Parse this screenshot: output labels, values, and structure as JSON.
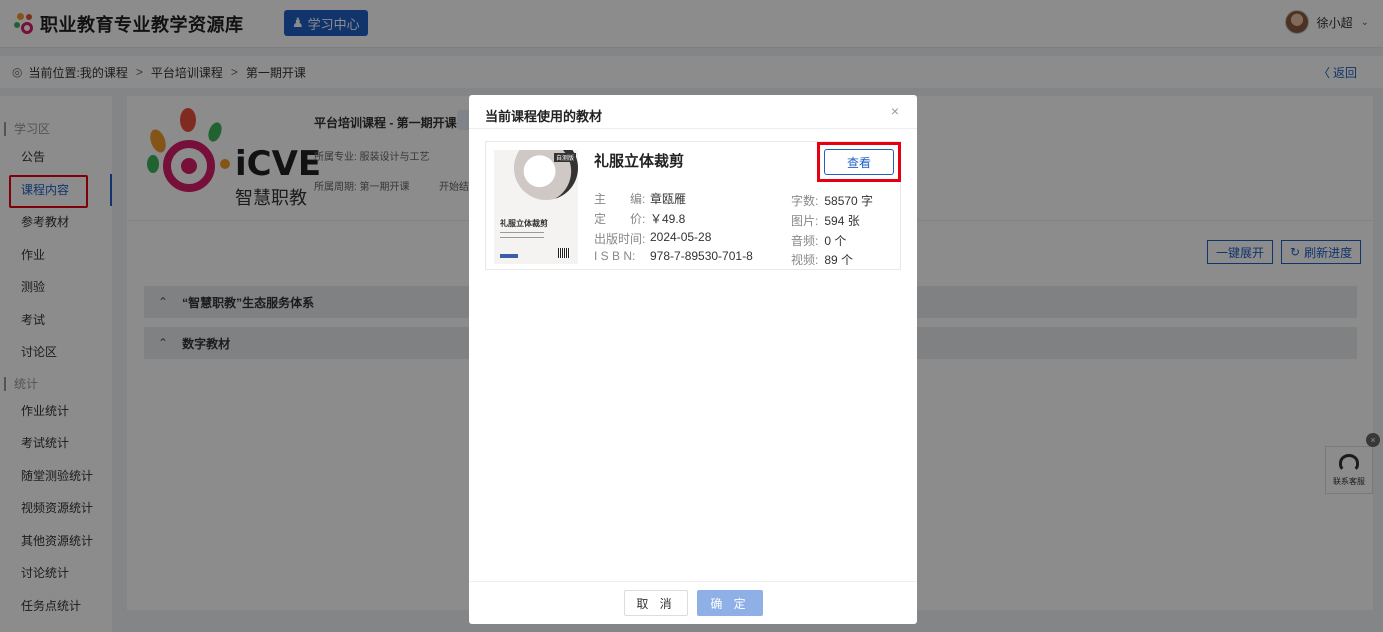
{
  "header": {
    "app_title": "职业教育专业教学资源库",
    "learning_center": "学习中心",
    "user_name": "徐小超"
  },
  "breadcrumb": {
    "prefix": "当前位置:",
    "items": [
      "我的课程",
      "平台培训课程",
      "第一期开课"
    ],
    "back": "返回"
  },
  "sidebar": {
    "section_study": "学习区",
    "study_items": [
      "公告",
      "课程内容",
      "参考教材",
      "作业",
      "测验",
      "考试",
      "讨论区"
    ],
    "section_stats": "统计",
    "stats_items": [
      "作业统计",
      "考试统计",
      "随堂测验统计",
      "视频资源统计",
      "其他资源统计",
      "讨论统计",
      "任务点统计"
    ]
  },
  "course": {
    "title": "平台培训课程 - 第一期开课",
    "major": "所属专业: 服装设计与工艺",
    "period": "所属周期: 第一期开课",
    "start": "开始结",
    "logo_text": "iCVE",
    "logo_subtext": "智慧职教"
  },
  "toolbar": {
    "expand_all": "一键展开",
    "refresh": "刷新进度"
  },
  "sections": [
    "“智慧职教”生态服务体系",
    "数字教材"
  ],
  "service": {
    "label": "联系客服"
  },
  "modal": {
    "title": "当前课程使用的教材",
    "book": {
      "title": "礼服立体裁剪",
      "view": "查看",
      "cover_badge": "自测版",
      "cover_title": "礼服立体裁剪",
      "editor_label": "主　　编:",
      "editor": "章瓯雁",
      "price_label": "定　　价:",
      "price": "￥49.8",
      "date_label": "出版时间:",
      "date": "2024-05-28",
      "isbn_label": "I S B N:",
      "isbn": "978-7-89530-701-8",
      "words_label": "字数:",
      "words": "58570 字",
      "images_label": "图片:",
      "images": "594 张",
      "audio_label": "音频:",
      "audio": "0 个",
      "video_label": "视频:",
      "video": "89 个"
    },
    "cancel": "取 消",
    "ok": "确 定"
  }
}
